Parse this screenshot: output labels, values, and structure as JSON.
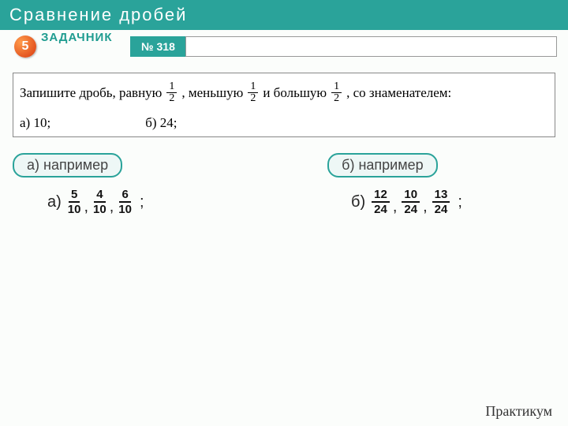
{
  "header": {
    "title": "Сравнение дробей"
  },
  "toolbar": {
    "grade": "5",
    "book": "ЗАДАЧНИК",
    "task_no": "№ 318"
  },
  "problem": {
    "t1": "Запишите дробь, равную",
    "t2": ", меньшую",
    "t3": "и большую",
    "t4": ", со знаменателем:",
    "half_n": "1",
    "half_d": "2",
    "sub_a": "а)  10;",
    "sub_b": "б)  24;"
  },
  "chips": {
    "a": "а) например",
    "b": "б) например"
  },
  "answers": {
    "a": {
      "label": "а)",
      "f1": {
        "n": "5",
        "d": "10"
      },
      "f2": {
        "n": "4",
        "d": "10"
      },
      "f3": {
        "n": "6",
        "d": "10"
      }
    },
    "b": {
      "label": "б)",
      "f1": {
        "n": "12",
        "d": "24"
      },
      "f2": {
        "n": "10",
        "d": "24"
      },
      "f3": {
        "n": "13",
        "d": "24"
      }
    },
    "comma": ",",
    "semicolon": ";"
  },
  "footer": {
    "text": "Практикум"
  }
}
